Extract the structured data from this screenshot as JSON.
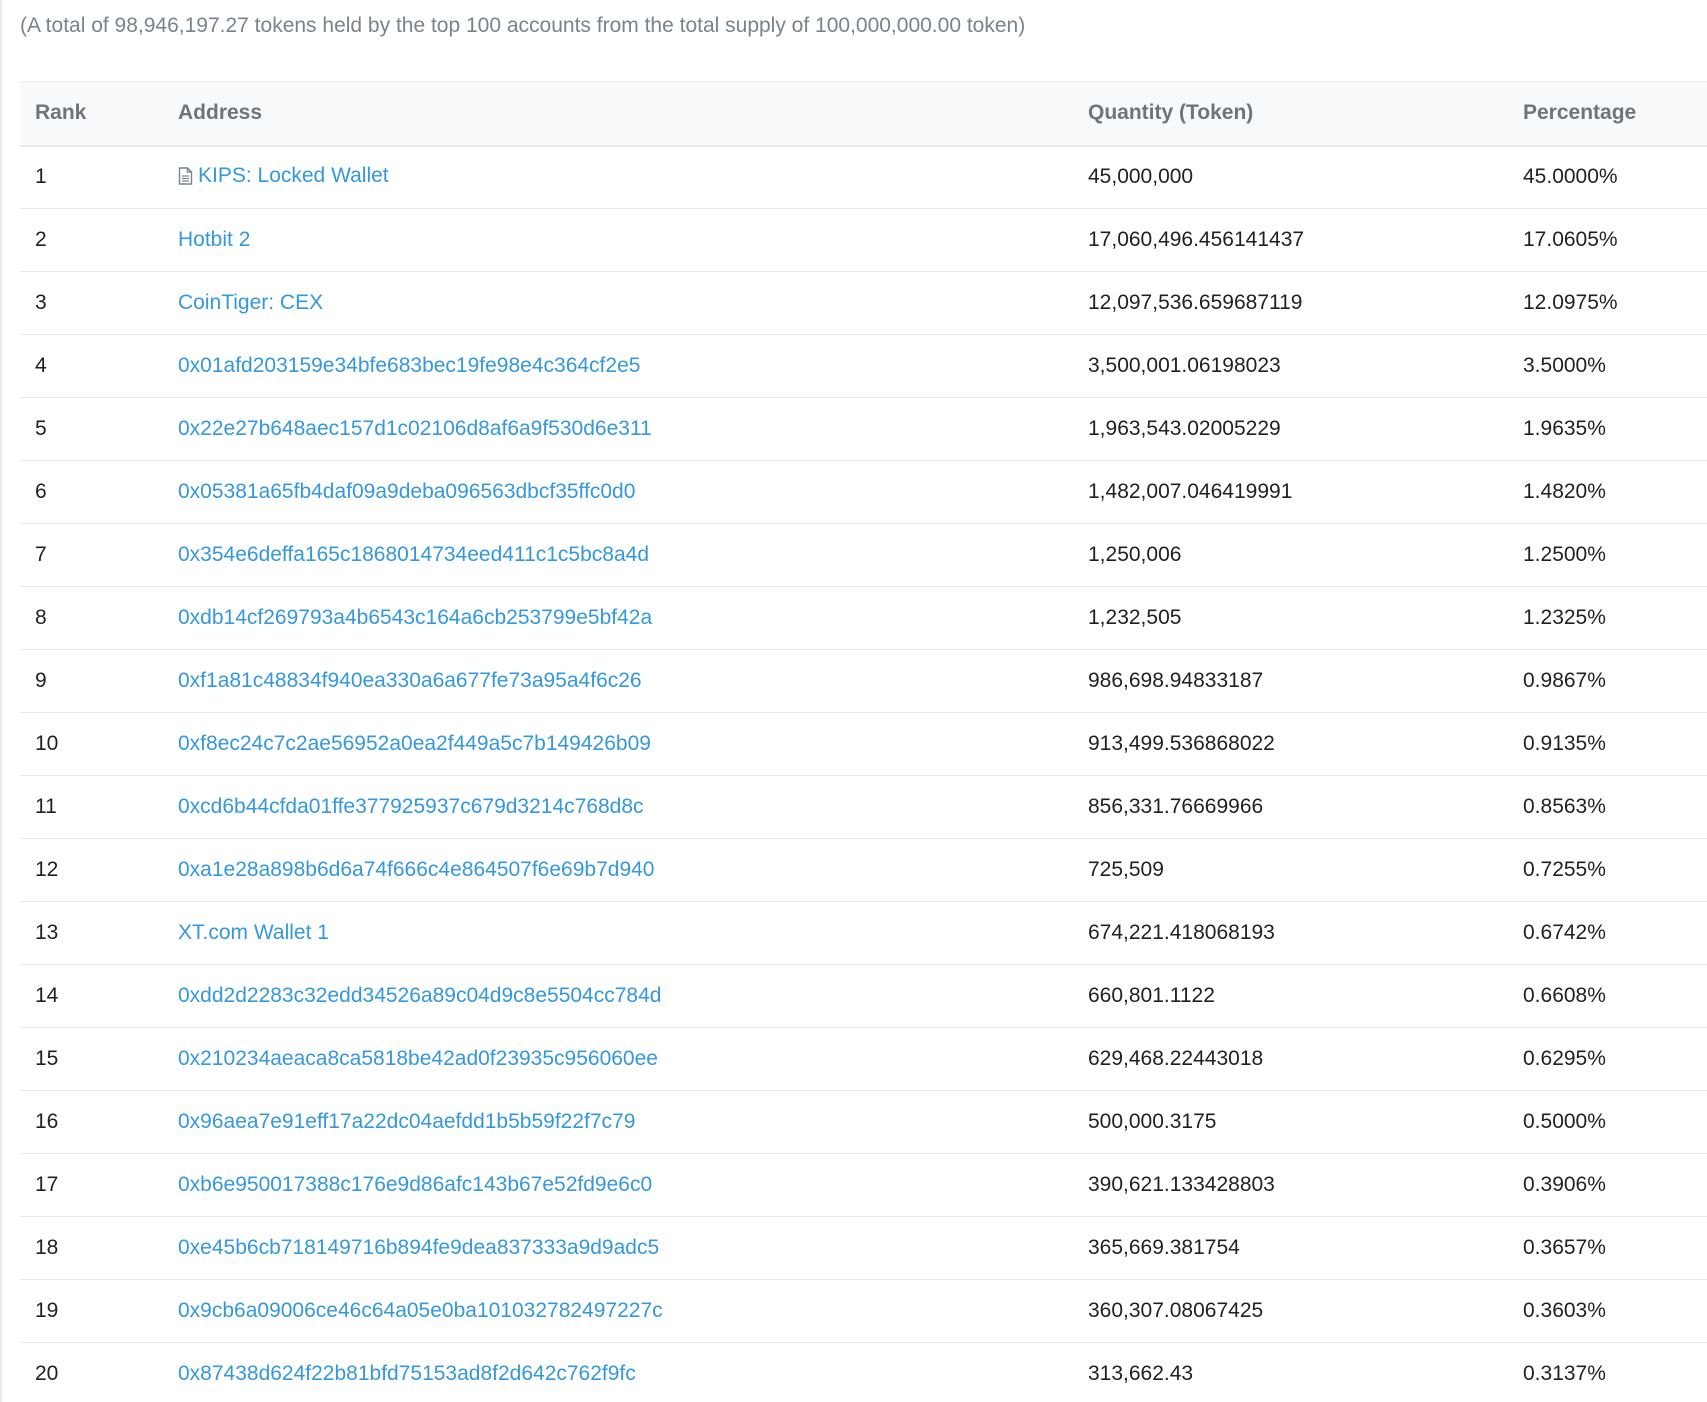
{
  "summary": "(A total of 98,946,197.27 tokens held by the top 100 accounts from the total supply of 100,000,000.00 token)",
  "table": {
    "headers": {
      "rank": "Rank",
      "address": "Address",
      "quantity": "Quantity (Token)",
      "percentage": "Percentage"
    },
    "rows": [
      {
        "rank": "1",
        "address": "KIPS: Locked Wallet",
        "icon": "contract-document-icon",
        "quantity": "45,000,000",
        "percentage": "45.0000%"
      },
      {
        "rank": "2",
        "address": "Hotbit 2",
        "quantity": "17,060,496.456141437",
        "percentage": "17.0605%"
      },
      {
        "rank": "3",
        "address": "CoinTiger: CEX",
        "quantity": "12,097,536.659687119",
        "percentage": "12.0975%"
      },
      {
        "rank": "4",
        "address": "0x01afd203159e34bfe683bec19fe98e4c364cf2e5",
        "quantity": "3,500,001.06198023",
        "percentage": "3.5000%"
      },
      {
        "rank": "5",
        "address": "0x22e27b648aec157d1c02106d8af6a9f530d6e311",
        "quantity": "1,963,543.02005229",
        "percentage": "1.9635%"
      },
      {
        "rank": "6",
        "address": "0x05381a65fb4daf09a9deba096563dbcf35ffc0d0",
        "quantity": "1,482,007.046419991",
        "percentage": "1.4820%"
      },
      {
        "rank": "7",
        "address": "0x354e6deffa165c1868014734eed411c1c5bc8a4d",
        "quantity": "1,250,006",
        "percentage": "1.2500%"
      },
      {
        "rank": "8",
        "address": "0xdb14cf269793a4b6543c164a6cb253799e5bf42a",
        "quantity": "1,232,505",
        "percentage": "1.2325%"
      },
      {
        "rank": "9",
        "address": "0xf1a81c48834f940ea330a6a677fe73a95a4f6c26",
        "quantity": "986,698.94833187",
        "percentage": "0.9867%"
      },
      {
        "rank": "10",
        "address": "0xf8ec24c7c2ae56952a0ea2f449a5c7b149426b09",
        "quantity": "913,499.536868022",
        "percentage": "0.9135%"
      },
      {
        "rank": "11",
        "address": "0xcd6b44cfda01ffe377925937c679d3214c768d8c",
        "quantity": "856,331.76669966",
        "percentage": "0.8563%"
      },
      {
        "rank": "12",
        "address": "0xa1e28a898b6d6a74f666c4e864507f6e69b7d940",
        "quantity": "725,509",
        "percentage": "0.7255%"
      },
      {
        "rank": "13",
        "address": "XT.com Wallet 1",
        "quantity": "674,221.418068193",
        "percentage": "0.6742%"
      },
      {
        "rank": "14",
        "address": "0xdd2d2283c32edd34526a89c04d9c8e5504cc784d",
        "quantity": "660,801.1122",
        "percentage": "0.6608%"
      },
      {
        "rank": "15",
        "address": "0x210234aeaca8ca5818be42ad0f23935c956060ee",
        "quantity": "629,468.22443018",
        "percentage": "0.6295%"
      },
      {
        "rank": "16",
        "address": "0x96aea7e91eff17a22dc04aefdd1b5b59f22f7c79",
        "quantity": "500,000.3175",
        "percentage": "0.5000%"
      },
      {
        "rank": "17",
        "address": "0xb6e950017388c176e9d86afc143b67e52fd9e6c0",
        "quantity": "390,621.133428803",
        "percentage": "0.3906%"
      },
      {
        "rank": "18",
        "address": "0xe45b6cb718149716b894fe9dea837333a9d9adc5",
        "quantity": "365,669.381754",
        "percentage": "0.3657%"
      },
      {
        "rank": "19",
        "address": "0x9cb6a09006ce46c64a05e0ba101032782497227c",
        "quantity": "360,307.08067425",
        "percentage": "0.3603%"
      },
      {
        "rank": "20",
        "address": "0x87438d624f22b81bfd75153ad8f2d642c762f9fc",
        "quantity": "313,662.43",
        "percentage": "0.3137%"
      }
    ]
  },
  "colors": {
    "link": "#3498db",
    "muted_text": "#77838f",
    "header_text": "#6c757d",
    "border": "#e7eaf3"
  }
}
